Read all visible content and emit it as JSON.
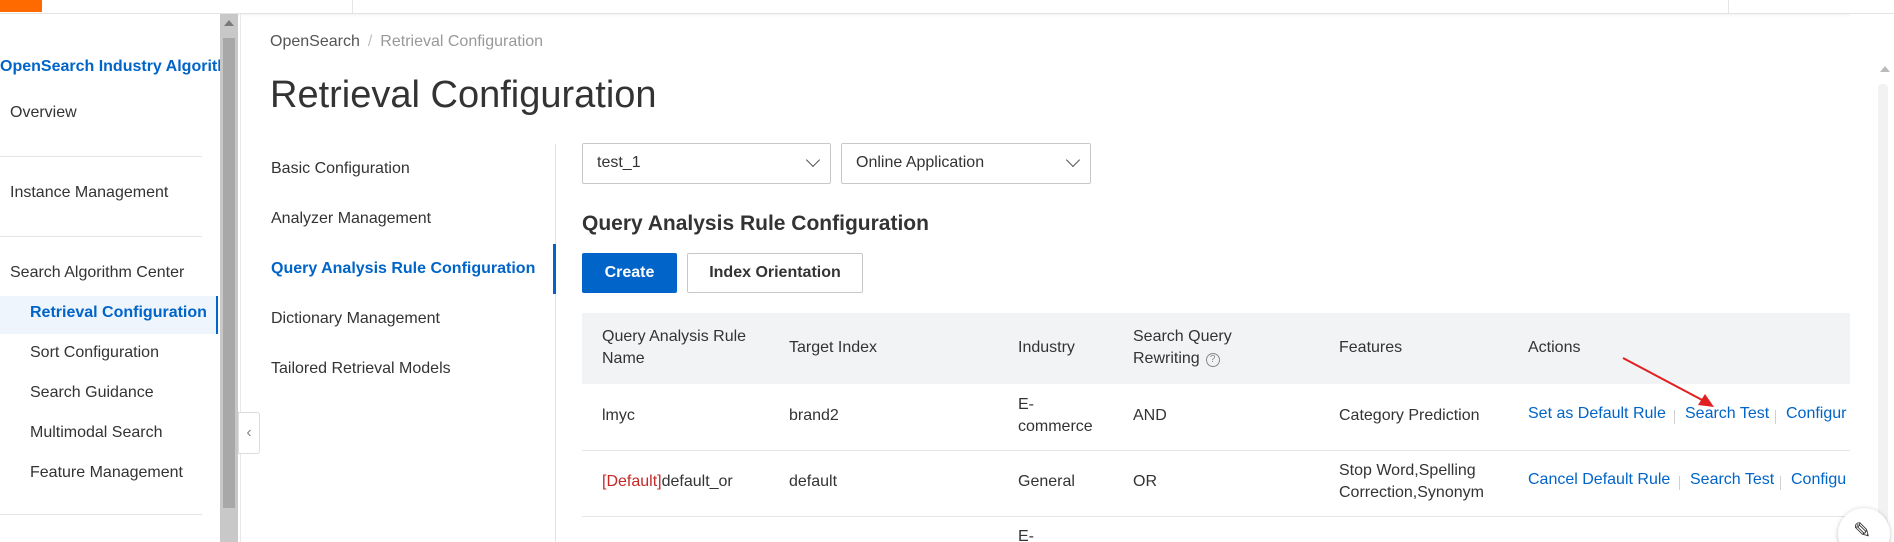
{
  "sidebar": {
    "title": "OpenSearch Industry Algorithm",
    "items": [
      {
        "label": "Overview"
      },
      {
        "label": "Instance Management"
      },
      {
        "label": "Search Algorithm Center"
      }
    ],
    "subitems": [
      {
        "label": "Retrieval Configuration",
        "active": true
      },
      {
        "label": "Sort Configuration"
      },
      {
        "label": "Search Guidance"
      },
      {
        "label": "Multimodal Search"
      },
      {
        "label": "Feature Management"
      }
    ]
  },
  "breadcrumb": {
    "root": "OpenSearch",
    "separator": "/",
    "current": "Retrieval Configuration"
  },
  "page": {
    "title": "Retrieval Configuration"
  },
  "subnav": [
    {
      "label": "Basic Configuration"
    },
    {
      "label": "Analyzer Management"
    },
    {
      "label": "Query Analysis Rule Configuration",
      "active": true
    },
    {
      "label": "Dictionary Management"
    },
    {
      "label": "Tailored Retrieval Models"
    }
  ],
  "filters": {
    "instance": "test_1",
    "application": "Online Application"
  },
  "section": {
    "title": "Query Analysis Rule Configuration"
  },
  "buttons": {
    "create": "Create",
    "index_orientation": "Index Orientation"
  },
  "table": {
    "headers": {
      "name_line1": "Query Analysis Rule",
      "name_line2": "Name",
      "target_index": "Target Index",
      "industry": "Industry",
      "rewriting_line1": "Search Query",
      "rewriting_line2": "Rewriting",
      "help": "?",
      "features": "Features",
      "actions": "Actions"
    },
    "rows": [
      {
        "default_tag": "",
        "name": "lmyc",
        "target_index": "brand2",
        "industry_line1": "E-",
        "industry_line2": "commerce",
        "rewriting": "AND",
        "features_line1": "Category Prediction",
        "features_line2": "",
        "action_1": "Set as Default Rule",
        "action_2": "Search Test",
        "action_3": "Configur"
      },
      {
        "default_tag": "[Default]",
        "name": "default_or",
        "target_index": "default",
        "industry_line1": "General",
        "industry_line2": "",
        "rewriting": "OR",
        "features_line1": "Stop Word,Spelling",
        "features_line2": "Correction,Synonym",
        "action_1": "Cancel Default Rule",
        "action_2": "Search Test",
        "action_3": "Configu"
      },
      {
        "industry_line1": "E-"
      }
    ]
  },
  "icons": {
    "collapse": "chevron-left-icon",
    "select_arrow": "chevron-down-icon",
    "help": "question-circle-icon",
    "edit": "pencil-icon",
    "annotation": "red-arrow-icon"
  },
  "colors": {
    "primary": "#0064c8",
    "brand": "#ff6a00",
    "default_tag": "#c62828",
    "annotation": "#e02020"
  }
}
